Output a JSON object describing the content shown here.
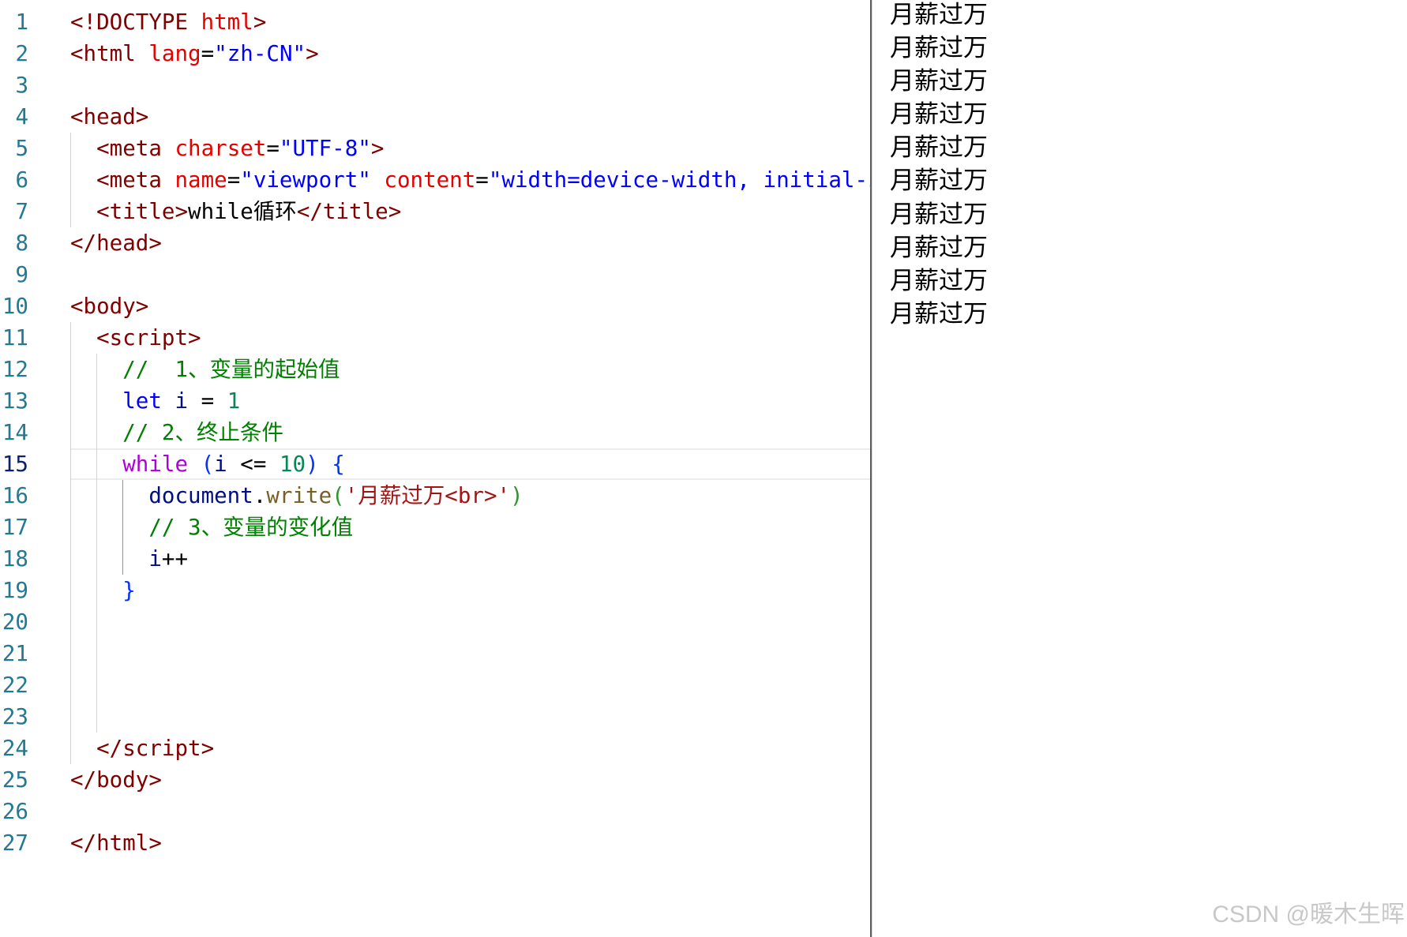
{
  "editor": {
    "active_line": 15,
    "colors": {
      "tag": "#800000",
      "attr": "#e50000",
      "attrval": "#0000ff",
      "plain": "#000000",
      "comment": "#008000",
      "keyword": "#0000ff",
      "control": "#af00db",
      "variable": "#001080",
      "number": "#098658",
      "bracket1": "#0431fa",
      "bracket2": "#319331",
      "func": "#795e26",
      "jsstring": "#a31515",
      "line_number": "#237893",
      "line_number_active": "#0b216f"
    },
    "lines": [
      {
        "number": "1",
        "tokens": [
          {
            "text": "<!DOCTYPE",
            "kind": "tag"
          },
          {
            "text": " html",
            "kind": "attr"
          },
          {
            "text": ">",
            "kind": "tag"
          }
        ]
      },
      {
        "number": "2",
        "tokens": [
          {
            "text": "<html",
            "kind": "tag"
          },
          {
            "text": " lang",
            "kind": "attr"
          },
          {
            "text": "=",
            "kind": "plain"
          },
          {
            "text": "\"zh-CN\"",
            "kind": "attrval"
          },
          {
            "text": ">",
            "kind": "tag"
          }
        ]
      },
      {
        "number": "3",
        "tokens": []
      },
      {
        "number": "4",
        "tokens": [
          {
            "text": "<head>",
            "kind": "tag"
          }
        ]
      },
      {
        "number": "5",
        "tokens": [
          {
            "text": "  <meta",
            "kind": "tag"
          },
          {
            "text": " charset",
            "kind": "attr"
          },
          {
            "text": "=",
            "kind": "plain"
          },
          {
            "text": "\"UTF-8\"",
            "kind": "attrval"
          },
          {
            "text": ">",
            "kind": "tag"
          }
        ]
      },
      {
        "number": "6",
        "tokens": [
          {
            "text": "  <meta",
            "kind": "tag"
          },
          {
            "text": " name",
            "kind": "attr"
          },
          {
            "text": "=",
            "kind": "plain"
          },
          {
            "text": "\"viewport\"",
            "kind": "attrval"
          },
          {
            "text": " content",
            "kind": "attr"
          },
          {
            "text": "=",
            "kind": "plain"
          },
          {
            "text": "\"width=device-width, initial-s",
            "kind": "attrval"
          }
        ]
      },
      {
        "number": "7",
        "tokens": [
          {
            "text": "  <title>",
            "kind": "tag"
          },
          {
            "text": "while循环",
            "kind": "plain"
          },
          {
            "text": "</title>",
            "kind": "tag"
          }
        ]
      },
      {
        "number": "8",
        "tokens": [
          {
            "text": "</head>",
            "kind": "tag"
          }
        ]
      },
      {
        "number": "9",
        "tokens": []
      },
      {
        "number": "10",
        "tokens": [
          {
            "text": "<body>",
            "kind": "tag"
          }
        ]
      },
      {
        "number": "11",
        "tokens": [
          {
            "text": "  <script>",
            "kind": "tag"
          }
        ]
      },
      {
        "number": "12",
        "tokens": [
          {
            "text": "    //  1、变量的起始值",
            "kind": "comment"
          }
        ]
      },
      {
        "number": "13",
        "tokens": [
          {
            "text": "    let",
            "kind": "keyword"
          },
          {
            "text": " i",
            "kind": "variable"
          },
          {
            "text": " = ",
            "kind": "plain"
          },
          {
            "text": "1",
            "kind": "number"
          }
        ]
      },
      {
        "number": "14",
        "tokens": [
          {
            "text": "    // 2、终止条件",
            "kind": "comment"
          }
        ]
      },
      {
        "number": "15",
        "tokens": [
          {
            "text": "    while",
            "kind": "control"
          },
          {
            "text": " ",
            "kind": "plain"
          },
          {
            "text": "(",
            "kind": "bracket1"
          },
          {
            "text": "i",
            "kind": "variable"
          },
          {
            "text": " <= ",
            "kind": "plain"
          },
          {
            "text": "10",
            "kind": "number"
          },
          {
            "text": ")",
            "kind": "bracket1"
          },
          {
            "text": " ",
            "kind": "plain"
          },
          {
            "text": "{",
            "kind": "bracket1"
          }
        ]
      },
      {
        "number": "16",
        "tokens": [
          {
            "text": "      document",
            "kind": "variable"
          },
          {
            "text": ".",
            "kind": "plain"
          },
          {
            "text": "write",
            "kind": "func"
          },
          {
            "text": "(",
            "kind": "bracket2"
          },
          {
            "text": "'月薪过万<br>'",
            "kind": "jsstring"
          },
          {
            "text": ")",
            "kind": "bracket2"
          }
        ]
      },
      {
        "number": "17",
        "tokens": [
          {
            "text": "      // 3、变量的变化值",
            "kind": "comment"
          }
        ]
      },
      {
        "number": "18",
        "tokens": [
          {
            "text": "      i",
            "kind": "variable"
          },
          {
            "text": "++",
            "kind": "plain"
          }
        ]
      },
      {
        "number": "19",
        "tokens": [
          {
            "text": "    }",
            "kind": "bracket1"
          }
        ]
      },
      {
        "number": "20",
        "tokens": []
      },
      {
        "number": "21",
        "tokens": []
      },
      {
        "number": "22",
        "tokens": []
      },
      {
        "number": "23",
        "tokens": []
      },
      {
        "number": "24",
        "tokens": [
          {
            "text": "  </script>",
            "kind": "tag"
          }
        ]
      },
      {
        "number": "25",
        "tokens": [
          {
            "text": "</body>",
            "kind": "tag"
          }
        ]
      },
      {
        "number": "26",
        "tokens": []
      },
      {
        "number": "27",
        "tokens": [
          {
            "text": "</html>",
            "kind": "tag"
          }
        ]
      }
    ]
  },
  "preview": {
    "output_lines": [
      "月薪过万",
      "月薪过万",
      "月薪过万",
      "月薪过万",
      "月薪过万",
      "月薪过万",
      "月薪过万",
      "月薪过万",
      "月薪过万",
      "月薪过万"
    ]
  },
  "watermark": "CSDN @暖木生晖"
}
